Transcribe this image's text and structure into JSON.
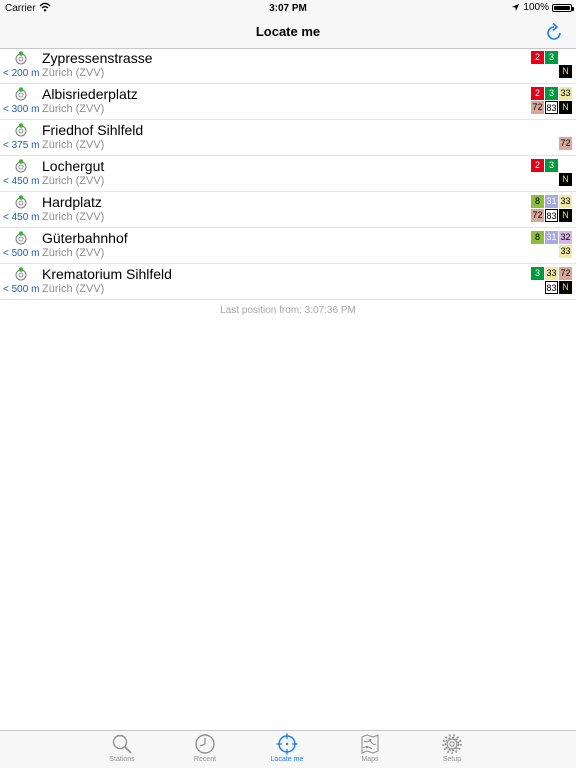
{
  "status": {
    "carrier": "Carrier",
    "time": "3:07 PM",
    "battery": "100%"
  },
  "nav": {
    "title": "Locate me"
  },
  "stations": [
    {
      "name": "Zypressenstrasse",
      "network": "Zürich (ZVV)",
      "distance": "< 200 m",
      "lines": [
        {
          "label": "2",
          "bg": "#e2001a",
          "fg": "#ffffff",
          "border": ""
        },
        {
          "label": "3",
          "bg": "#009a3e",
          "fg": "#ffffff",
          "border": ""
        },
        {
          "label": "",
          "bg": "transparent",
          "fg": "#000",
          "border": ""
        },
        {
          "label": "N",
          "bg": "#000000",
          "fg": "#f7e02a",
          "border": ""
        }
      ]
    },
    {
      "name": "Albisriederplatz",
      "network": "Zürich (ZVV)",
      "distance": "< 300 m",
      "lines": [
        {
          "label": "2",
          "bg": "#e2001a",
          "fg": "#ffffff",
          "border": ""
        },
        {
          "label": "3",
          "bg": "#009a3e",
          "fg": "#ffffff",
          "border": ""
        },
        {
          "label": "33",
          "bg": "#f0e9a5",
          "fg": "#000000",
          "border": ""
        },
        {
          "label": "72",
          "bg": "#d9a79a",
          "fg": "#000000",
          "border": ""
        },
        {
          "label": "83",
          "bg": "#ffffff",
          "fg": "#000000",
          "border": "#000000"
        },
        {
          "label": "N",
          "bg": "#000000",
          "fg": "#f7e02a",
          "border": ""
        }
      ]
    },
    {
      "name": "Friedhof Sihlfeld",
      "network": "Zürich (ZVV)",
      "distance": "< 375 m",
      "lines": [
        {
          "label": "",
          "bg": "transparent",
          "fg": "#000",
          "border": ""
        },
        {
          "label": "",
          "bg": "transparent",
          "fg": "#000",
          "border": ""
        },
        {
          "label": "",
          "bg": "transparent",
          "fg": "#000",
          "border": ""
        },
        {
          "label": "",
          "bg": "transparent",
          "fg": "#000",
          "border": ""
        },
        {
          "label": "",
          "bg": "transparent",
          "fg": "#000",
          "border": ""
        },
        {
          "label": "72",
          "bg": "#d9a79a",
          "fg": "#000000",
          "border": ""
        }
      ]
    },
    {
      "name": "Lochergut",
      "network": "Zürich (ZVV)",
      "distance": "< 450 m",
      "lines": [
        {
          "label": "2",
          "bg": "#e2001a",
          "fg": "#ffffff",
          "border": ""
        },
        {
          "label": "3",
          "bg": "#009a3e",
          "fg": "#ffffff",
          "border": ""
        },
        {
          "label": "",
          "bg": "transparent",
          "fg": "#000",
          "border": ""
        },
        {
          "label": "N",
          "bg": "#000000",
          "fg": "#f7e02a",
          "border": ""
        }
      ]
    },
    {
      "name": "Hardplatz",
      "network": "Zürich (ZVV)",
      "distance": "< 450 m",
      "lines": [
        {
          "label": "8",
          "bg": "#8dbf3c",
          "fg": "#000000",
          "border": ""
        },
        {
          "label": "31",
          "bg": "#a7a9e0",
          "fg": "#ffffff",
          "border": ""
        },
        {
          "label": "33",
          "bg": "#f0e9a5",
          "fg": "#000000",
          "border": ""
        },
        {
          "label": "72",
          "bg": "#d9a79a",
          "fg": "#000000",
          "border": ""
        },
        {
          "label": "83",
          "bg": "#ffffff",
          "fg": "#000000",
          "border": "#000000"
        },
        {
          "label": "N",
          "bg": "#000000",
          "fg": "#f7e02a",
          "border": ""
        }
      ]
    },
    {
      "name": "Güterbahnhof",
      "network": "Zürich (ZVV)",
      "distance": "< 500 m",
      "lines": [
        {
          "label": "8",
          "bg": "#8dbf3c",
          "fg": "#000000",
          "border": ""
        },
        {
          "label": "31",
          "bg": "#a7a9e0",
          "fg": "#ffffff",
          "border": ""
        },
        {
          "label": "32",
          "bg": "#d6b7e3",
          "fg": "#000000",
          "border": ""
        },
        {
          "label": "33",
          "bg": "#f0e9a5",
          "fg": "#000000",
          "border": ""
        }
      ]
    },
    {
      "name": "Krematorium Sihlfeld",
      "network": "Zürich (ZVV)",
      "distance": "< 500 m",
      "lines": [
        {
          "label": "3",
          "bg": "#009a3e",
          "fg": "#ffffff",
          "border": ""
        },
        {
          "label": "33",
          "bg": "#f0e9a5",
          "fg": "#000000",
          "border": ""
        },
        {
          "label": "72",
          "bg": "#d9a79a",
          "fg": "#000000",
          "border": ""
        },
        {
          "label": "83",
          "bg": "#ffffff",
          "fg": "#000000",
          "border": "#000000"
        },
        {
          "label": "N",
          "bg": "#000000",
          "fg": "#f7e02a",
          "border": ""
        }
      ]
    }
  ],
  "footer_note": "Last position from: 3:07:36 PM",
  "tabs": [
    {
      "label": "Stations",
      "icon": "search-icon",
      "active": false
    },
    {
      "label": "Recent",
      "icon": "clock-icon",
      "active": false
    },
    {
      "label": "Locate me",
      "icon": "crosshair-icon",
      "active": true
    },
    {
      "label": "Maps",
      "icon": "map-icon",
      "active": false
    },
    {
      "label": "Setup",
      "icon": "gear-icon",
      "active": false
    }
  ],
  "colors": {
    "accent": "#1a7cf5",
    "distance": "#1c5fb0",
    "secondary_text": "#8e8e93"
  }
}
